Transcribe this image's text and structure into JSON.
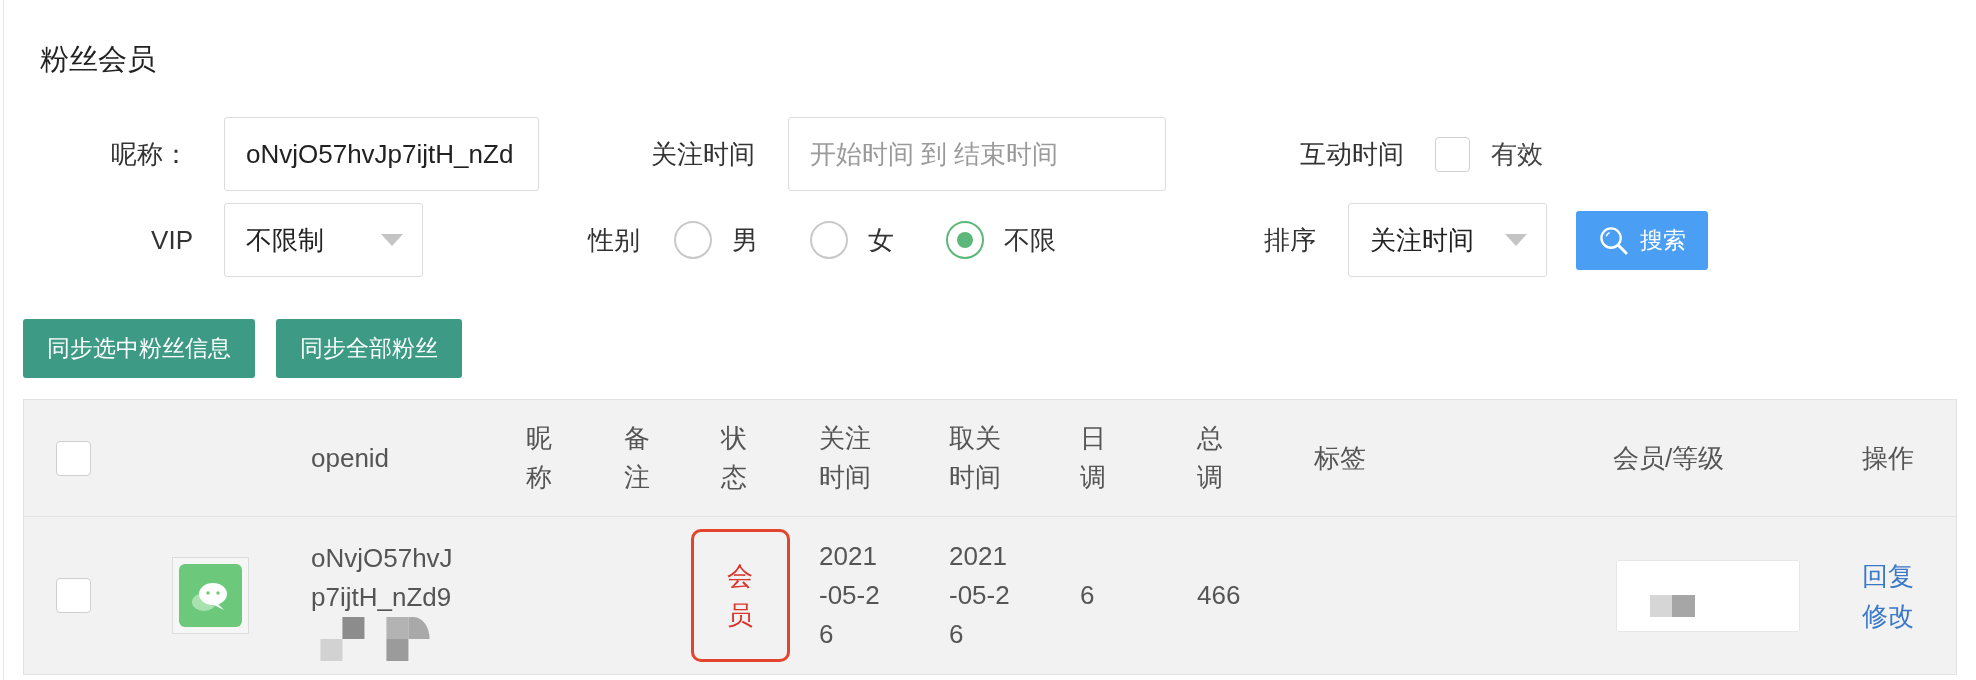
{
  "page": {
    "title": "粉丝会员"
  },
  "filters": {
    "nickname": {
      "label": "呢称：",
      "value": "oNvjO57hvJp7ijtH_nZd"
    },
    "follow_time": {
      "label": "关注时间",
      "placeholder": "开始时间 到 结束时间"
    },
    "interaction_time": {
      "label": "互动时间",
      "option": "有效",
      "checked": false
    },
    "vip": {
      "label": "VIP",
      "value": "不限制"
    },
    "gender": {
      "label": "性别",
      "options": [
        {
          "label": "男",
          "selected": false
        },
        {
          "label": "女",
          "selected": false
        },
        {
          "label": "不限",
          "selected": true
        }
      ]
    },
    "sort": {
      "label": "排序",
      "value": "关注时间"
    },
    "search_button": "搜索"
  },
  "actions": [
    "同步选中粉丝信息",
    "同步全部粉丝"
  ],
  "table": {
    "header_checked": false,
    "columns": [
      "openid",
      "昵称",
      "备注",
      "状态",
      "关注时间",
      "取关时间",
      "日调",
      "总调",
      "标签",
      "会员/等级",
      "操作"
    ],
    "rows": [
      {
        "checked": false,
        "openid": "oNvjO57hvJp7ijtH_nZd9",
        "status": "会员",
        "status_highlighted": true,
        "follow_time": "2021-05-26",
        "unfollow_time": "2021-05-26",
        "daily": "6",
        "total": "466",
        "actions": [
          "回复",
          "修改"
        ]
      }
    ]
  }
}
